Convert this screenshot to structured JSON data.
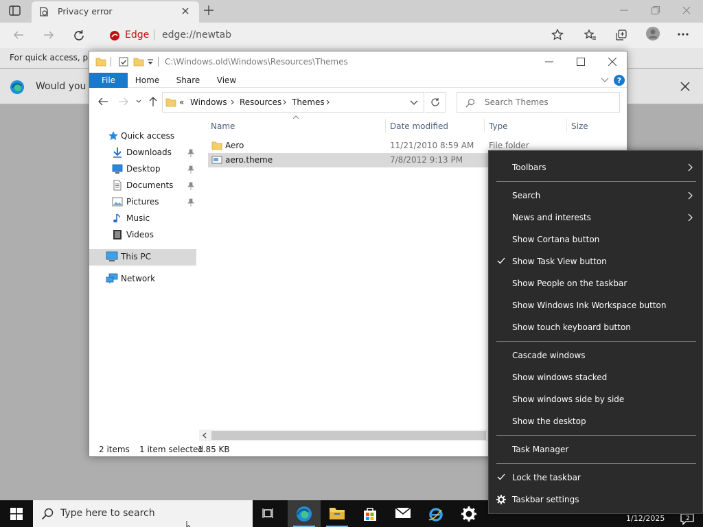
{
  "browser": {
    "tab_title": "Privacy error",
    "brand": "Edge",
    "url": "edge://newtab",
    "favorites_hint": "For quick access, plac",
    "info_text": "Would you lik"
  },
  "explorer": {
    "title_path": "C:\\Windows.old\\Windows\\Resources\\Themes",
    "ribbon": {
      "file": "File",
      "home": "Home",
      "share": "Share",
      "view": "View"
    },
    "address": {
      "overflow": "«",
      "crumbs": [
        "Windows",
        "Resources",
        "Themes"
      ]
    },
    "search_placeholder": "Search Themes",
    "nav": {
      "quick_access": "Quick access",
      "downloads": "Downloads",
      "desktop": "Desktop",
      "documents": "Documents",
      "pictures": "Pictures",
      "music": "Music",
      "videos": "Videos",
      "this_pc": "This PC",
      "network": "Network"
    },
    "columns": {
      "name": "Name",
      "date": "Date modified",
      "type": "Type",
      "size": "Size"
    },
    "files": [
      {
        "name": "Aero",
        "date": "11/21/2010 8:59 AM",
        "type": "File folder"
      },
      {
        "name": "aero.theme",
        "date": "7/8/2012 9:13 PM",
        "type": ""
      }
    ],
    "status": {
      "count": "2 items",
      "selected": "1 item selected",
      "size": "1.85 KB"
    }
  },
  "context_menu": {
    "toolbars": "Toolbars",
    "search": "Search",
    "news": "News and interests",
    "cortana": "Show Cortana button",
    "task_view": "Show Task View button",
    "people": "Show People on the taskbar",
    "ink": "Show Windows Ink Workspace button",
    "touch_kb": "Show touch keyboard button",
    "cascade": "Cascade windows",
    "stacked": "Show windows stacked",
    "side_by_side": "Show windows side by side",
    "show_desktop": "Show the desktop",
    "task_manager": "Task Manager",
    "lock": "Lock the taskbar",
    "settings": "Taskbar settings"
  },
  "taskbar": {
    "search_placeholder": "Type here to search",
    "clock_date": "1/12/2025",
    "notif_count": "2"
  },
  "colors": {
    "ribbon_file": "#1979ca",
    "menu_bg": "#2b2b2b",
    "taskbar_bg": "#101010",
    "edge_brand": "#c01010"
  }
}
